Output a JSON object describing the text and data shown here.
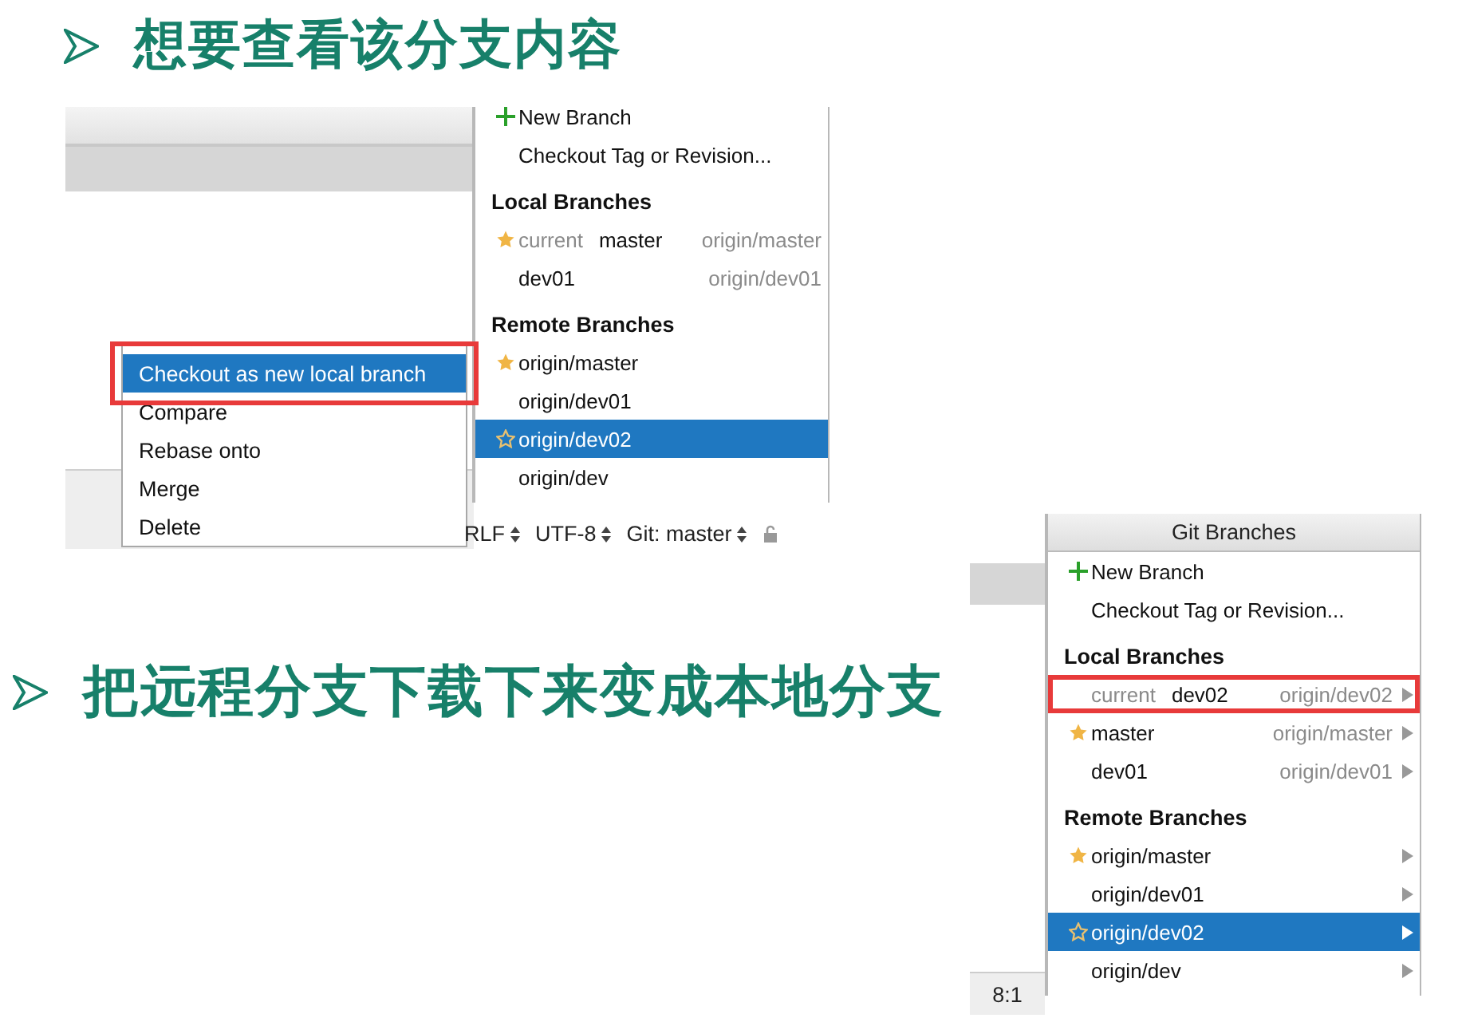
{
  "headings": [
    {
      "text": "想要查看该分支内容"
    },
    {
      "text": "把远程分支下载下来变成本地分支"
    }
  ],
  "screenshot_1": {
    "branches_popup": {
      "items": [
        {
          "kind": "action",
          "label": "New Branch",
          "plus": true
        },
        {
          "kind": "action",
          "label": "Checkout Tag or Revision...",
          "plus": false
        },
        {
          "kind": "header",
          "label": "Local Branches"
        },
        {
          "kind": "branch",
          "current_label": "current",
          "name": "master",
          "tracking": "origin/master",
          "favorite": true,
          "selected": false,
          "highlighted": false,
          "submenu": false
        },
        {
          "kind": "branch",
          "name": "dev01",
          "tracking": "origin/dev01",
          "favorite": false,
          "selected": false,
          "highlighted": false,
          "submenu": false
        },
        {
          "kind": "header",
          "label": "Remote Branches"
        },
        {
          "kind": "branch",
          "name": "origin/master",
          "favorite": true,
          "selected": false,
          "highlighted": false,
          "submenu": false
        },
        {
          "kind": "branch",
          "name": "origin/dev01",
          "favorite": false,
          "selected": false,
          "highlighted": false,
          "submenu": false
        },
        {
          "kind": "branch",
          "name": "origin/dev02",
          "favorite": false,
          "selected": true,
          "highlighted": false,
          "submenu": false
        },
        {
          "kind": "branch",
          "name": "origin/dev",
          "favorite": false,
          "selected": false,
          "highlighted": false,
          "submenu": false
        }
      ]
    },
    "context_menu": {
      "items": [
        {
          "label": "Checkout as new local branch",
          "selected": true,
          "highlighted": true
        },
        {
          "label": "Compare",
          "selected": false,
          "highlighted": false
        },
        {
          "label": "Rebase onto",
          "selected": false,
          "highlighted": false
        },
        {
          "label": "Merge",
          "selected": false,
          "highlighted": false
        },
        {
          "label": "Delete",
          "selected": false,
          "highlighted": false
        }
      ]
    },
    "status_bar": [
      "RLF",
      "UTF-8",
      "Git: master"
    ]
  },
  "screenshot_2": {
    "branches_popup": {
      "title": "Git Branches",
      "items": [
        {
          "kind": "action",
          "label": "New Branch",
          "plus": true
        },
        {
          "kind": "action",
          "label": "Checkout Tag or Revision...",
          "plus": false
        },
        {
          "kind": "header",
          "label": "Local Branches"
        },
        {
          "kind": "branch",
          "current_label": "current",
          "name": "dev02",
          "tracking": "origin/dev02",
          "favorite": false,
          "selected": false,
          "highlighted": true,
          "submenu": true
        },
        {
          "kind": "branch",
          "name": "master",
          "tracking": "origin/master",
          "favorite": true,
          "selected": false,
          "highlighted": false,
          "submenu": true
        },
        {
          "kind": "branch",
          "name": "dev01",
          "tracking": "origin/dev01",
          "favorite": false,
          "selected": false,
          "highlighted": false,
          "submenu": true
        },
        {
          "kind": "header",
          "label": "Remote Branches"
        },
        {
          "kind": "branch",
          "name": "origin/master",
          "favorite": true,
          "selected": false,
          "highlighted": false,
          "submenu": true
        },
        {
          "kind": "branch",
          "name": "origin/dev01",
          "favorite": false,
          "selected": false,
          "highlighted": false,
          "submenu": true
        },
        {
          "kind": "branch",
          "name": "origin/dev02",
          "favorite": false,
          "selected": true,
          "highlighted": false,
          "submenu": true
        },
        {
          "kind": "branch",
          "name": "origin/dev",
          "favorite": false,
          "selected": false,
          "highlighted": false,
          "submenu": true
        }
      ]
    },
    "status_bar": [
      "8:1"
    ]
  }
}
